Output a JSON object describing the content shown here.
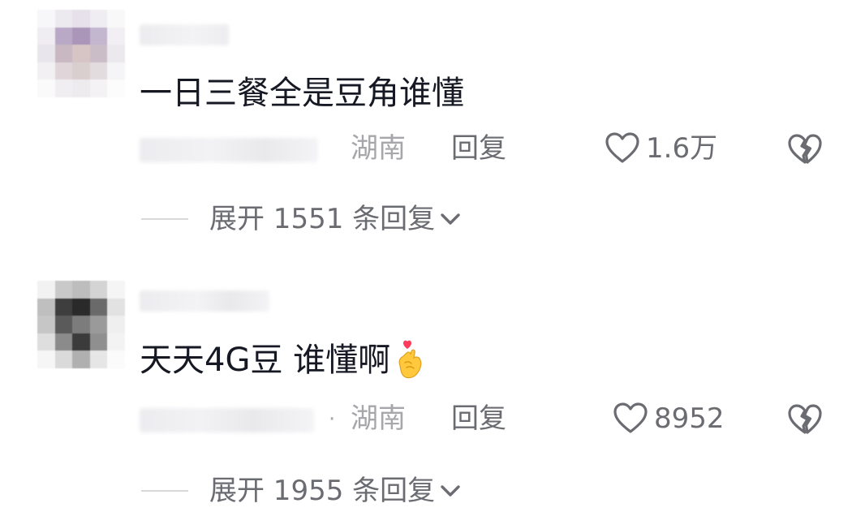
{
  "comments": [
    {
      "text": "一日三餐全是豆角谁懂",
      "location": "湖南",
      "reply_label": "回复",
      "likes": "1.6万",
      "expand_label": "展开 1551 条回复",
      "has_dot": false,
      "has_emoji": false
    },
    {
      "text": "天天4G豆 谁懂啊",
      "location": "湖南",
      "reply_label": "回复",
      "likes": "8952",
      "expand_label": "展开 1955 条回复",
      "has_dot": true,
      "dot": "·",
      "has_emoji": true,
      "emoji": "finger-heart-emoji"
    }
  ],
  "colors": {
    "primary_text": "#161823",
    "secondary_text": "#6b6c72",
    "muted_text": "#a6a6ab",
    "divider": "#d8d8da",
    "heart_red": "#ff3b5c",
    "emoji_yellow": "#ffc83d"
  }
}
